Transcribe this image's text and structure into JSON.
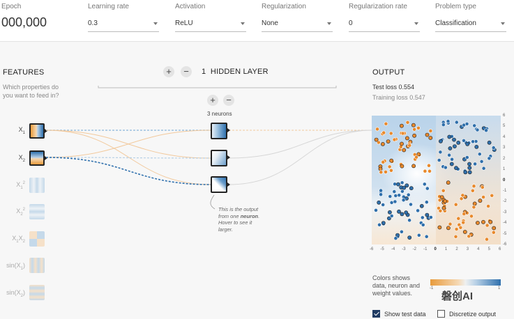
{
  "topbar": {
    "epoch": {
      "label": "Epoch",
      "value": "000,000"
    },
    "learning_rate": {
      "label": "Learning rate",
      "value": "0.3"
    },
    "activation": {
      "label": "Activation",
      "value": "ReLU"
    },
    "regularization": {
      "label": "Regularization",
      "value": "None"
    },
    "regularization_rate": {
      "label": "Regularization rate",
      "value": "0"
    },
    "problem_type": {
      "label": "Problem type",
      "value": "Classification"
    }
  },
  "features": {
    "title": "FEATURES",
    "subtitle_line1": "Which properties do",
    "subtitle_line2": "you want to feed in?",
    "items": [
      {
        "base": "X",
        "sub": "1",
        "sup": "",
        "active": true
      },
      {
        "base": "X",
        "sub": "2",
        "sup": "",
        "active": true
      },
      {
        "base": "X",
        "sub": "1",
        "sup": "2",
        "active": false
      },
      {
        "base": "X",
        "sub": "2",
        "sup": "2",
        "active": false
      },
      {
        "base": "X",
        "sub": "1",
        "base2": "X",
        "sub2": "2",
        "active": false
      },
      {
        "base": "sin(X",
        "sub": "1",
        "tail": ")",
        "active": false
      },
      {
        "base": "sin(X",
        "sub": "2",
        "tail": ")",
        "active": false
      }
    ]
  },
  "hidden": {
    "count": "1",
    "label": "HIDDEN LAYER",
    "plus": "+",
    "minus": "−",
    "neurons_label": "3 neurons",
    "callout_line1": "This is the output",
    "callout_line2_pre": "from one ",
    "callout_line2_bold": "neuron",
    "callout_line2_post": ".",
    "callout_line3": "Hover to see it",
    "callout_line4": "larger."
  },
  "output": {
    "title": "OUTPUT",
    "test_loss_label": "Test loss",
    "test_loss": "0.554",
    "training_loss_label": "Training loss",
    "training_loss": "0.547",
    "x_ticks": [
      "-6",
      "-5",
      "-4",
      "-3",
      "-2",
      "-1",
      "0",
      "1",
      "2",
      "3",
      "4",
      "5",
      "6"
    ],
    "y_ticks": [
      "6",
      "5",
      "4",
      "3",
      "2",
      "1",
      "0",
      "-1",
      "-2",
      "-3",
      "-4",
      "-5",
      "-6"
    ],
    "legend_line1": "Colors shows",
    "legend_line2": "data, neuron and",
    "legend_line3": "weight values.",
    "legend_min": "-1",
    "legend_max": "1",
    "show_test_data": {
      "label": "Show test data",
      "checked": true
    },
    "discretize_output": {
      "label": "Discretize output",
      "checked": false
    }
  },
  "watermark": "磐创AI",
  "colors": {
    "orange": "#e8892c",
    "blue": "#2f6fab",
    "light_blue": "#9cc1df",
    "light_orange": "#f4cfa3"
  }
}
